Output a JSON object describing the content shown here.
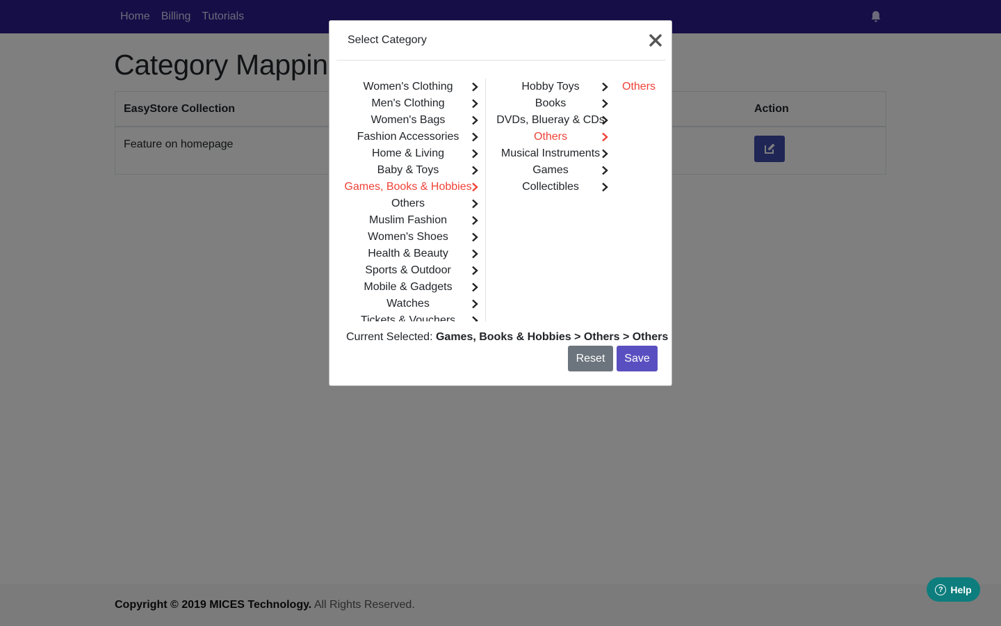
{
  "nav": {
    "links": [
      "Home",
      "Billing",
      "Tutorials"
    ],
    "icons": {
      "notification": "bell-icon"
    }
  },
  "page": {
    "title": "Category Mapping",
    "table": {
      "headers": {
        "collection": "EasyStore Collection",
        "action": "Action"
      },
      "rows": [
        {
          "collection": "Feature on homepage"
        }
      ]
    }
  },
  "footer": {
    "copyright_prefix": "Copyright © 2019",
    "company": "MICES Technology.",
    "suffix": "All Rights Reserved."
  },
  "help": {
    "label": "Help",
    "icon_glyph": "?"
  },
  "modal": {
    "title": "Select Category",
    "column1": [
      "Women's Clothing",
      "Men's Clothing",
      "Women's Bags",
      "Fashion Accessories",
      "Home & Living",
      "Baby & Toys",
      "Games, Books & Hobbies",
      "Others",
      "Muslim Fashion",
      "Women's Shoes",
      "Health & Beauty",
      "Sports & Outdoor",
      "Mobile & Gadgets",
      "Watches",
      "Tickets & Vouchers"
    ],
    "column1_active": 6,
    "column2": [
      "Hobby Toys",
      "Books",
      "DVDs, Blueray & CDs",
      "Others",
      "Musical Instruments",
      "Games",
      "Collectibles"
    ],
    "column2_active": 3,
    "column3": [
      "Others"
    ],
    "column3_active": 0,
    "current_label": "Current Selected:",
    "current_value": "Games, Books & Hobbies > Others > Others",
    "reset_label": "Reset",
    "save_label": "Save"
  },
  "colors": {
    "navbar": "#2c1d8f",
    "active": "#ef4136",
    "save": "#5a4fc0",
    "reset": "#6c757d",
    "edit": "#3e4aa8",
    "help": "#0d7d7d"
  }
}
